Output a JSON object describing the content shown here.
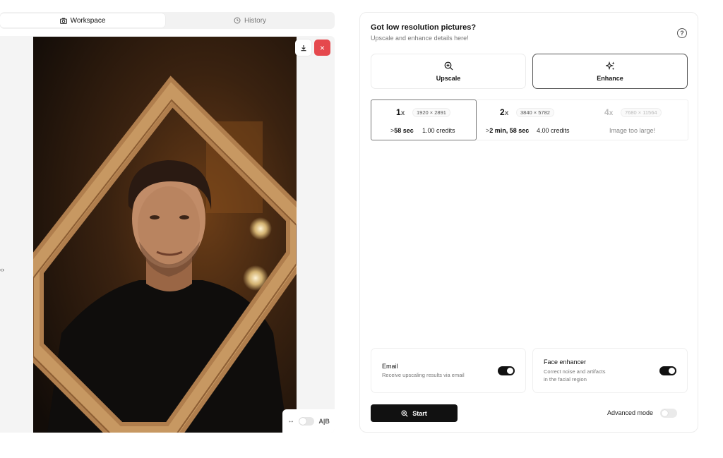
{
  "workspace": {
    "tabs": [
      {
        "label": "Workspace",
        "icon": "camera-icon",
        "active": true
      },
      {
        "label": "History",
        "icon": "history-icon",
        "active": false
      }
    ],
    "compare_handle": "‹›",
    "image": {
      "subject": "man-holding-wooden-frame"
    },
    "ab_label": "A|B"
  },
  "panel": {
    "title": "Got low resolution pictures?",
    "subtitle": "Upscale and enhance details here!",
    "modes": [
      {
        "label": "Upscale",
        "icon": "zoom-in-icon",
        "selected": false
      },
      {
        "label": "Enhance",
        "icon": "sparkles-icon",
        "selected": true
      }
    ],
    "scales": [
      {
        "factor": "1",
        "unit": "x",
        "dims": "1920 × 2891",
        "time_prefix": ">",
        "time": "58 sec",
        "credits": "1.00 credits",
        "selected": true
      },
      {
        "factor": "2",
        "unit": "x",
        "dims": "3840 × 5782",
        "time_prefix": ">",
        "time": "2 min, 58 sec",
        "credits": "4.00 credits",
        "selected": false
      },
      {
        "factor": "4",
        "unit": "x",
        "dims": "7680 × 11564",
        "note": "Image too large!",
        "disabled": true
      }
    ],
    "options": {
      "email": {
        "title": "Email",
        "desc": "Receive upscaling results via email",
        "enabled": true
      },
      "face": {
        "title": "Face enhancer",
        "desc1": "Correct noise and artifacts",
        "desc2": "in the facial region",
        "enabled": true
      }
    },
    "start_label": "Start",
    "advanced_label": "Advanced mode",
    "advanced_enabled": false
  },
  "colors": {
    "accent": "#111111",
    "danger": "#e5484d",
    "border": "#ececec"
  }
}
